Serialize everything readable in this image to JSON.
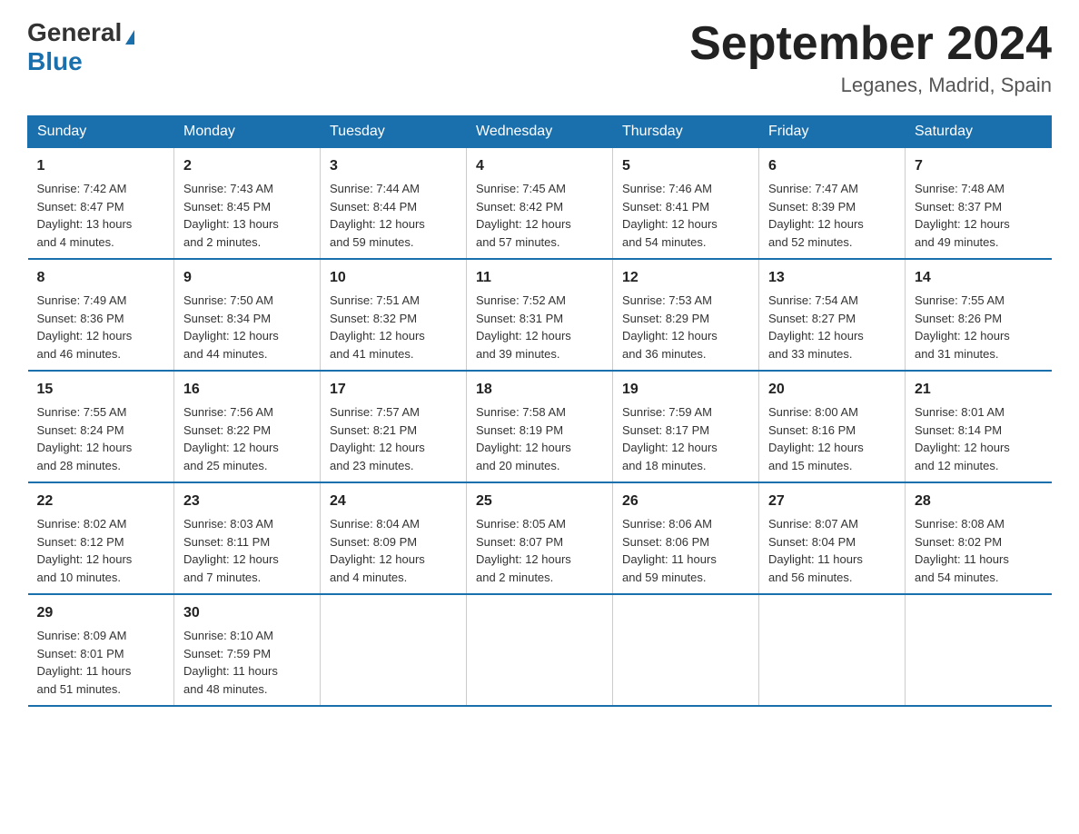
{
  "header": {
    "logo_general": "General",
    "logo_blue": "Blue",
    "month_title": "September 2024",
    "location": "Leganes, Madrid, Spain"
  },
  "weekdays": [
    "Sunday",
    "Monday",
    "Tuesday",
    "Wednesday",
    "Thursday",
    "Friday",
    "Saturday"
  ],
  "weeks": [
    [
      {
        "day": "1",
        "sunrise": "7:42 AM",
        "sunset": "8:47 PM",
        "daylight": "13 hours and 4 minutes."
      },
      {
        "day": "2",
        "sunrise": "7:43 AM",
        "sunset": "8:45 PM",
        "daylight": "13 hours and 2 minutes."
      },
      {
        "day": "3",
        "sunrise": "7:44 AM",
        "sunset": "8:44 PM",
        "daylight": "12 hours and 59 minutes."
      },
      {
        "day": "4",
        "sunrise": "7:45 AM",
        "sunset": "8:42 PM",
        "daylight": "12 hours and 57 minutes."
      },
      {
        "day": "5",
        "sunrise": "7:46 AM",
        "sunset": "8:41 PM",
        "daylight": "12 hours and 54 minutes."
      },
      {
        "day": "6",
        "sunrise": "7:47 AM",
        "sunset": "8:39 PM",
        "daylight": "12 hours and 52 minutes."
      },
      {
        "day": "7",
        "sunrise": "7:48 AM",
        "sunset": "8:37 PM",
        "daylight": "12 hours and 49 minutes."
      }
    ],
    [
      {
        "day": "8",
        "sunrise": "7:49 AM",
        "sunset": "8:36 PM",
        "daylight": "12 hours and 46 minutes."
      },
      {
        "day": "9",
        "sunrise": "7:50 AM",
        "sunset": "8:34 PM",
        "daylight": "12 hours and 44 minutes."
      },
      {
        "day": "10",
        "sunrise": "7:51 AM",
        "sunset": "8:32 PM",
        "daylight": "12 hours and 41 minutes."
      },
      {
        "day": "11",
        "sunrise": "7:52 AM",
        "sunset": "8:31 PM",
        "daylight": "12 hours and 39 minutes."
      },
      {
        "day": "12",
        "sunrise": "7:53 AM",
        "sunset": "8:29 PM",
        "daylight": "12 hours and 36 minutes."
      },
      {
        "day": "13",
        "sunrise": "7:54 AM",
        "sunset": "8:27 PM",
        "daylight": "12 hours and 33 minutes."
      },
      {
        "day": "14",
        "sunrise": "7:55 AM",
        "sunset": "8:26 PM",
        "daylight": "12 hours and 31 minutes."
      }
    ],
    [
      {
        "day": "15",
        "sunrise": "7:55 AM",
        "sunset": "8:24 PM",
        "daylight": "12 hours and 28 minutes."
      },
      {
        "day": "16",
        "sunrise": "7:56 AM",
        "sunset": "8:22 PM",
        "daylight": "12 hours and 25 minutes."
      },
      {
        "day": "17",
        "sunrise": "7:57 AM",
        "sunset": "8:21 PM",
        "daylight": "12 hours and 23 minutes."
      },
      {
        "day": "18",
        "sunrise": "7:58 AM",
        "sunset": "8:19 PM",
        "daylight": "12 hours and 20 minutes."
      },
      {
        "day": "19",
        "sunrise": "7:59 AM",
        "sunset": "8:17 PM",
        "daylight": "12 hours and 18 minutes."
      },
      {
        "day": "20",
        "sunrise": "8:00 AM",
        "sunset": "8:16 PM",
        "daylight": "12 hours and 15 minutes."
      },
      {
        "day": "21",
        "sunrise": "8:01 AM",
        "sunset": "8:14 PM",
        "daylight": "12 hours and 12 minutes."
      }
    ],
    [
      {
        "day": "22",
        "sunrise": "8:02 AM",
        "sunset": "8:12 PM",
        "daylight": "12 hours and 10 minutes."
      },
      {
        "day": "23",
        "sunrise": "8:03 AM",
        "sunset": "8:11 PM",
        "daylight": "12 hours and 7 minutes."
      },
      {
        "day": "24",
        "sunrise": "8:04 AM",
        "sunset": "8:09 PM",
        "daylight": "12 hours and 4 minutes."
      },
      {
        "day": "25",
        "sunrise": "8:05 AM",
        "sunset": "8:07 PM",
        "daylight": "12 hours and 2 minutes."
      },
      {
        "day": "26",
        "sunrise": "8:06 AM",
        "sunset": "8:06 PM",
        "daylight": "11 hours and 59 minutes."
      },
      {
        "day": "27",
        "sunrise": "8:07 AM",
        "sunset": "8:04 PM",
        "daylight": "11 hours and 56 minutes."
      },
      {
        "day": "28",
        "sunrise": "8:08 AM",
        "sunset": "8:02 PM",
        "daylight": "11 hours and 54 minutes."
      }
    ],
    [
      {
        "day": "29",
        "sunrise": "8:09 AM",
        "sunset": "8:01 PM",
        "daylight": "11 hours and 51 minutes."
      },
      {
        "day": "30",
        "sunrise": "8:10 AM",
        "sunset": "7:59 PM",
        "daylight": "11 hours and 48 minutes."
      },
      null,
      null,
      null,
      null,
      null
    ]
  ],
  "labels": {
    "sunrise": "Sunrise:",
    "sunset": "Sunset:",
    "daylight": "Daylight:"
  }
}
